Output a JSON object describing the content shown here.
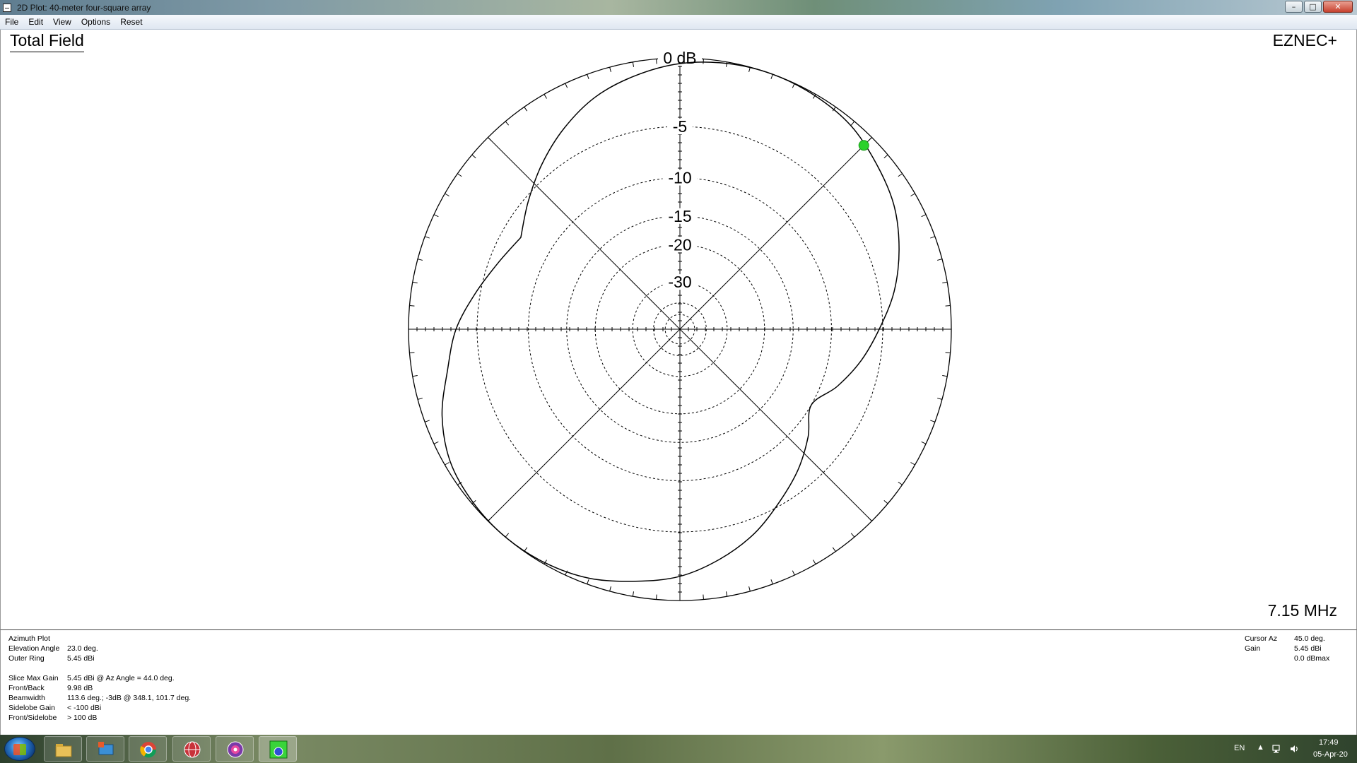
{
  "window": {
    "title": "2D Plot: 40-meter four-square array",
    "buttons": {
      "minimize": "–",
      "maximize": "□",
      "close": "✕"
    }
  },
  "menu": [
    "File",
    "Edit",
    "View",
    "Options",
    "Reset"
  ],
  "plot": {
    "title": "Total Field",
    "brand": "EZNEC+",
    "frequency": "7.15 MHz",
    "ring_labels": [
      "0 dB",
      "-5",
      "-10",
      "-15",
      "-20",
      "-30"
    ]
  },
  "chart_data": {
    "type": "polar",
    "outer_ring_dbi": 5.45,
    "ring_db": [
      0,
      -5,
      -10,
      -15,
      -20,
      -30,
      -40,
      -50
    ],
    "pattern_gain_db": [
      -6.7,
      -5.4,
      -4.0,
      -2.7,
      -1.6,
      -0.9,
      -0.36,
      -0.09,
      0.0,
      -0.1,
      -0.35,
      -0.95,
      -1.6,
      -2.6,
      -3.8,
      -5.3,
      -6.7,
      -8.3,
      -9.98,
      -8.3,
      -6.7,
      -5.3,
      -3.8,
      -2.6,
      -1.6,
      -1.0,
      -0.4,
      -0.1,
      0.0,
      -0.1,
      -0.4,
      -1.2,
      -2.4,
      -3.3,
      -4.6,
      -5.8,
      -6.7
    ],
    "pattern_az_deg": [
      -60,
      -50,
      -40,
      -30,
      -20,
      -10,
      0,
      10,
      20,
      30,
      40,
      50,
      60,
      70,
      80,
      90,
      100,
      110,
      120,
      130,
      140,
      150,
      160,
      170,
      180,
      190,
      200,
      210,
      220,
      230,
      240,
      250,
      260,
      270,
      280,
      290,
      300
    ],
    "cursor": {
      "az_deg": 45.0,
      "gain_db": 0.0
    }
  },
  "info": {
    "left": [
      {
        "label": "Azimuth Plot",
        "value": ""
      },
      {
        "label": "Elevation Angle",
        "value": "23.0 deg."
      },
      {
        "label": "Outer Ring",
        "value": "5.45 dBi"
      },
      {
        "label": "",
        "value": ""
      },
      {
        "label": "Slice Max Gain",
        "value": "5.45 dBi @ Az Angle = 44.0 deg."
      },
      {
        "label": "Front/Back",
        "value": "9.98 dB"
      },
      {
        "label": "Beamwidth",
        "value": "113.6 deg.; -3dB @ 348.1, 101.7 deg."
      },
      {
        "label": "Sidelobe Gain",
        "value": "< -100 dBi"
      },
      {
        "label": "Front/Sidelobe",
        "value": "> 100 dB"
      }
    ],
    "right": [
      {
        "label": "Cursor Az",
        "value": "45.0 deg."
      },
      {
        "label": "Gain",
        "value": "5.45 dBi"
      },
      {
        "label": "",
        "value": "0.0 dBmax"
      }
    ]
  },
  "taskbar": {
    "apps": [
      "explorer-icon",
      "remote-icon",
      "chrome-icon",
      "globe-icon",
      "ham-logbook-icon",
      "eznec-icon"
    ],
    "tray": {
      "lang": "EN",
      "time": "17:49",
      "date": "05-Apr-20"
    }
  }
}
